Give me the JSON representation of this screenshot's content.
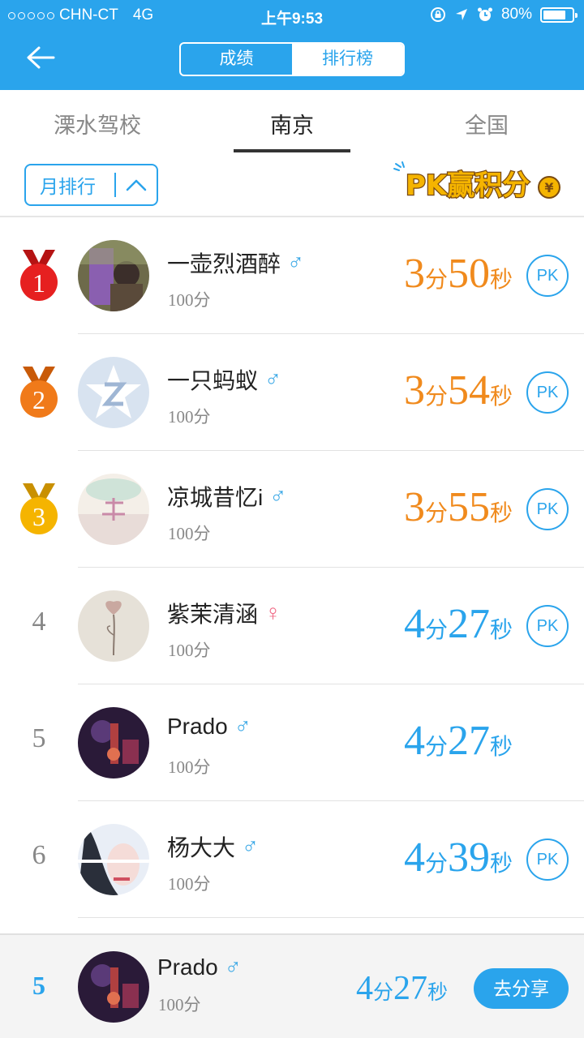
{
  "status": {
    "carrier": "CHN-CT",
    "network": "4G",
    "time": "上午9:53",
    "battery": "80%",
    "battery_level": 0.8
  },
  "header": {
    "segments": [
      "成绩",
      "排行榜"
    ],
    "active_segment": 1
  },
  "tabs": [
    "溧水驾校",
    "南京",
    "全国"
  ],
  "active_tab": 1,
  "filter": {
    "label": "月排行"
  },
  "pk_badge": {
    "text": "PK赢积分",
    "currency": "¥"
  },
  "colors": {
    "brand": "#2aa4ec",
    "top_time": "#f08a1d",
    "time": "#2aa4ec",
    "male": "#3aa8e6",
    "female": "#f06a86",
    "gold": "#f5b400",
    "silver": "#f07a1a",
    "red_medal": "#e62020"
  },
  "pk_label": "PK",
  "units": {
    "min": "分",
    "sec": "秒"
  },
  "rows": [
    {
      "rank": "1",
      "medal": "red",
      "name": "一壶烈酒醉",
      "gender": "♂",
      "score": "100分",
      "min": "3",
      "sec": "50",
      "pk": true
    },
    {
      "rank": "2",
      "medal": "orange",
      "name": "一只蚂蚁",
      "gender": "♂",
      "score": "100分",
      "min": "3",
      "sec": "54",
      "pk": true
    },
    {
      "rank": "3",
      "medal": "gold",
      "name": "凉城昔忆i",
      "gender": "♂",
      "score": "100分",
      "min": "3",
      "sec": "55",
      "pk": true
    },
    {
      "rank": "4",
      "medal": "",
      "name": "紫茉清涵",
      "gender": "♀",
      "score": "100分",
      "min": "4",
      "sec": "27",
      "pk": true
    },
    {
      "rank": "5",
      "medal": "",
      "name": "Prado",
      "gender": "♂",
      "score": "100分",
      "min": "4",
      "sec": "27",
      "pk": false
    },
    {
      "rank": "6",
      "medal": "",
      "name": "杨大大",
      "gender": "♂",
      "score": "100分",
      "min": "4",
      "sec": "39",
      "pk": true
    }
  ],
  "me": {
    "rank": "5",
    "name": "Prado",
    "gender": "♂",
    "score": "100分",
    "min": "4",
    "sec": "27",
    "share_label": "去分享"
  }
}
